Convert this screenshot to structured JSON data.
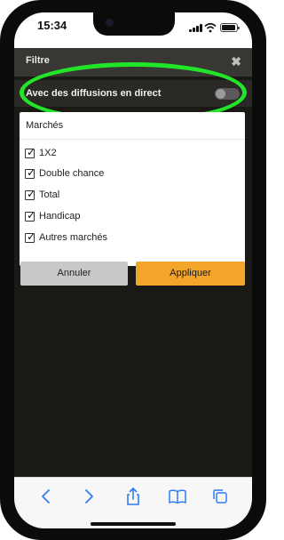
{
  "status": {
    "time": "15:34"
  },
  "filter": {
    "title": "Filtre",
    "close_icon": "✖"
  },
  "live": {
    "label": "Avec des diffusions en direct",
    "enabled": false
  },
  "markets": {
    "title": "Marchés",
    "items": [
      {
        "label": "1X2",
        "checked": true
      },
      {
        "label": "Double chance",
        "checked": true
      },
      {
        "label": "Total",
        "checked": true
      },
      {
        "label": "Handicap",
        "checked": true
      },
      {
        "label": "Autres marchés",
        "checked": true
      }
    ]
  },
  "actions": {
    "cancel": "Annuler",
    "apply": "Appliquer"
  },
  "colors": {
    "accent": "#f3a52a",
    "highlight": "#22e52a",
    "link": "#2f7cf6"
  },
  "icons": {
    "check": "✓"
  },
  "browser_nav": [
    "back-icon",
    "forward-icon",
    "share-icon",
    "bookmarks-icon",
    "tabs-icon"
  ]
}
